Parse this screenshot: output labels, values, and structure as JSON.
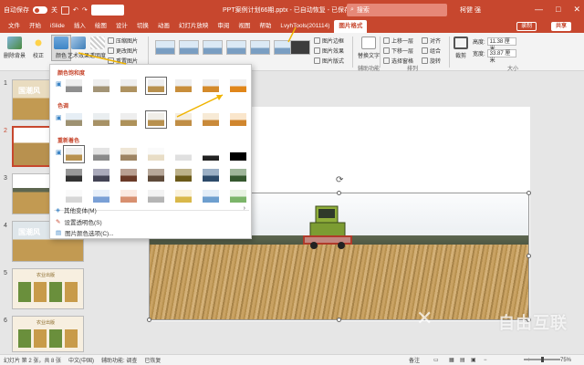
{
  "titlebar": {
    "autosave_label": "自动保存",
    "toggle_state": "关",
    "doc_title": "PPT案例计划66期.pptx - 已自动恢复 - 已保存到此台电脑",
    "search_placeholder": "搜索",
    "user_name": "柯健 强",
    "win_min": "—",
    "win_max": "□",
    "win_close": "✕"
  },
  "tabs": [
    "文件",
    "开始",
    "iSlide",
    "插入",
    "绘图",
    "设计",
    "切换",
    "动画",
    "幻灯片放映",
    "审阅",
    "视图",
    "帮助",
    "LvyhTools(201114)",
    "图片格式"
  ],
  "active_tab": "图片格式",
  "record_label": "录制",
  "share_label": "共享",
  "ribbon": {
    "remove_bg": "删除背景",
    "correct": "校正",
    "color": "颜色",
    "artistic": "艺术效果",
    "transparency": "透明度",
    "compress": "压缩图片",
    "change": "更改图片",
    "reset": "重置图片",
    "border": "图片边框",
    "effects": "图片效果",
    "layout": "图片版式",
    "alt_text": "替换文字",
    "accessibility": "辅助功能",
    "forward": "上移一层",
    "backward": "下移一层",
    "selection_pane": "选择窗格",
    "align": "对齐",
    "group": "组合",
    "rotate": "旋转",
    "arrange": "排列",
    "crop": "裁剪",
    "height_label": "高度:",
    "height_value": "11.38 厘米",
    "width_label": "宽度:",
    "width_value": "33.87 厘米",
    "size": "大小"
  },
  "dropdown": {
    "saturation_head": "颜色饱和度",
    "tone_head": "色调",
    "recolor_head": "重新着色",
    "more_variants": "其他变体(M)",
    "set_transparent": "设置透明色(S)",
    "color_options": "图片颜色选项(C)..."
  },
  "slides": [
    {
      "num": "1"
    },
    {
      "num": "2"
    },
    {
      "num": "3"
    },
    {
      "num": "4"
    },
    {
      "num": "5"
    },
    {
      "num": "6"
    }
  ],
  "slide_thumb_text": {
    "s1": "国潮风",
    "s4": "国潮风",
    "s5": "农业出版",
    "s6": "农业出版"
  },
  "status": {
    "slide_info": "幻灯片 第 2 张，共 8 张",
    "language": "中文(中国)",
    "accessibility": "辅助功能: 调查",
    "restored": "已恢复",
    "notes": "备注",
    "zoom": "75%"
  },
  "watermark": "自由互联",
  "colors": {
    "accent": "#c7472e",
    "annotation": "#f0b400"
  }
}
